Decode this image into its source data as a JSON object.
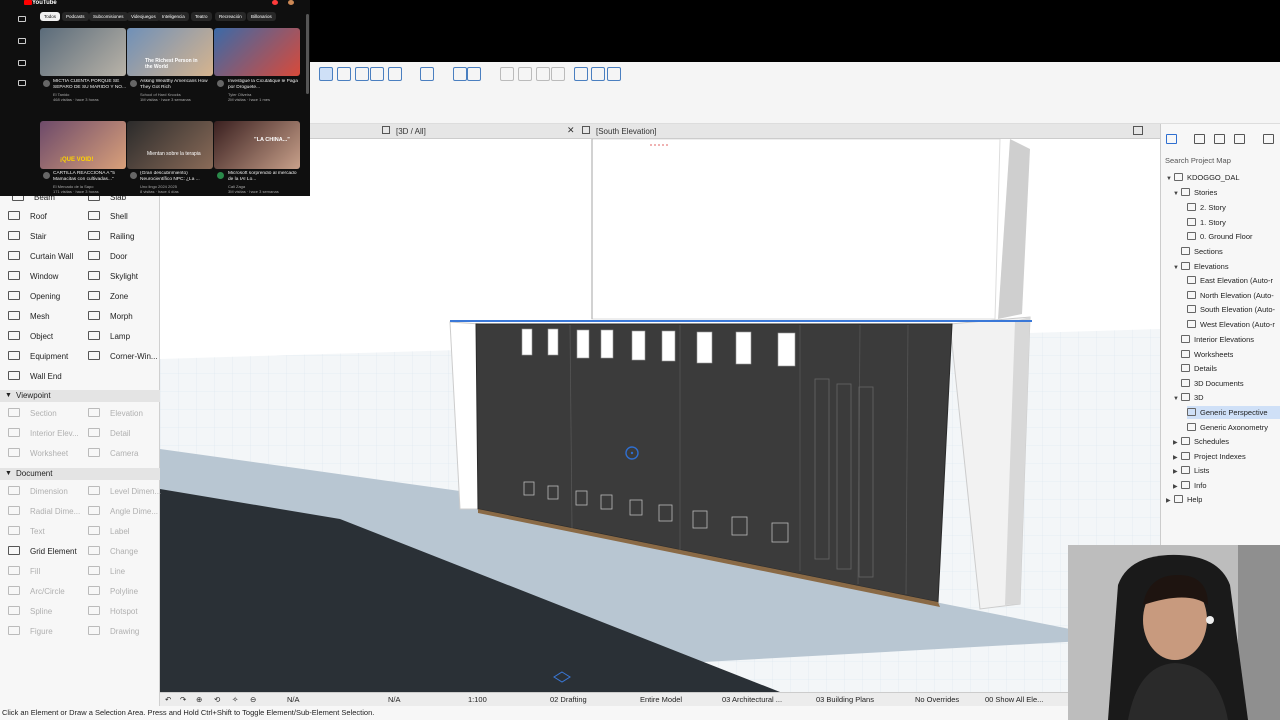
{
  "youtube": {
    "logo": "YouTube",
    "chips": [
      "Todos",
      "Podcasts",
      "Subcomisiones",
      "Videojuegos",
      "Inteligencia",
      "Teatro",
      "Recreación",
      "Billonarios"
    ],
    "videos": [
      {
        "title": "MICTIA CUENTA PORQUE SE SEPARO DE SU MARIDO Y NO...",
        "channel": "El Tanido",
        "meta": "468 visitas · hace 3 horas"
      },
      {
        "title": "Asking Wealthy Americans How They Got Rich",
        "channel": "School of Hard Knocks",
        "meta": "1M visitas · hace 3 semanas"
      },
      {
        "title": "Investigué la Cicutatique le Paga por Droguete...",
        "channel": "Tyler Oliveira",
        "meta": "2M visitas · hace 1 mes"
      },
      {
        "title": "CARTILLA REACCIONA A \"5 Mamacitas con cultivadas...\"",
        "channel": "El Mercado de la Sapo",
        "meta": "171 visitas · hace 3 horas"
      },
      {
        "title": "(Gran descubrimiento) Neurocientífico NPC: ¿La ...",
        "channel": "Uno lingo 2024 2025",
        "meta": "8 visitas · hace 4 días"
      },
      {
        "title": "Microsoft sorprendió al mercado de la IA! Lo...",
        "channel": "Cali Zaga",
        "meta": "3M visitas · hace 3 semanas"
      }
    ],
    "thumb_texts": [
      "The Richest Person in the World",
      "¡QUE VOID!",
      "Mientan sobre la terapia",
      "\"LA CHINA...\""
    ]
  },
  "tabs": [
    {
      "label": "[3D / All]"
    },
    {
      "label": "[South Elevation]"
    }
  ],
  "toolbox": {
    "tools": [
      {
        "label": "Beam"
      },
      {
        "label": "Slab"
      },
      {
        "label": "Roof"
      },
      {
        "label": "Shell"
      },
      {
        "label": "Stair"
      },
      {
        "label": "Railing"
      },
      {
        "label": "Curtain Wall"
      },
      {
        "label": "Door"
      },
      {
        "label": "Window"
      },
      {
        "label": "Skylight"
      },
      {
        "label": "Opening"
      },
      {
        "label": "Zone"
      },
      {
        "label": "Mesh"
      },
      {
        "label": "Morph"
      },
      {
        "label": "Object"
      },
      {
        "label": "Lamp"
      },
      {
        "label": "Equipment"
      },
      {
        "label": "Corner-Win..."
      },
      {
        "label": "Wall End"
      }
    ],
    "viewpoint_header": "Viewpoint",
    "viewpoint_tools": [
      {
        "label": "Section"
      },
      {
        "label": "Elevation"
      },
      {
        "label": "Interior Elev..."
      },
      {
        "label": "Detail"
      },
      {
        "label": "Worksheet"
      },
      {
        "label": "Camera"
      }
    ],
    "document_header": "Document",
    "document_tools": [
      {
        "label": "Dimension"
      },
      {
        "label": "Level Dimen..."
      },
      {
        "label": "Radial Dime..."
      },
      {
        "label": "Angle Dime..."
      },
      {
        "label": "Text"
      },
      {
        "label": "Label"
      },
      {
        "label": "Grid Element"
      },
      {
        "label": "Change"
      },
      {
        "label": "Fill"
      },
      {
        "label": "Line"
      },
      {
        "label": "Arc/Circle"
      },
      {
        "label": "Polyline"
      },
      {
        "label": "Spline"
      },
      {
        "label": "Hotspot"
      },
      {
        "label": "Figure"
      },
      {
        "label": "Drawing"
      }
    ]
  },
  "navigator": {
    "search_placeholder": "Search Project Map",
    "items": [
      {
        "label": "KDOGGO_DAL"
      },
      {
        "label": "Stories"
      },
      {
        "label": "2. Story"
      },
      {
        "label": "1. Story"
      },
      {
        "label": "0. Ground Floor"
      },
      {
        "label": "Sections"
      },
      {
        "label": "Elevations"
      },
      {
        "label": "East Elevation (Auto-r"
      },
      {
        "label": "North Elevation (Auto-"
      },
      {
        "label": "South Elevation (Auto-"
      },
      {
        "label": "West Elevation (Auto-r"
      },
      {
        "label": "Interior Elevations"
      },
      {
        "label": "Worksheets"
      },
      {
        "label": "Details"
      },
      {
        "label": "3D Documents"
      },
      {
        "label": "3D"
      },
      {
        "label": "Generic Perspective"
      },
      {
        "label": "Generic Axonometry"
      },
      {
        "label": "Schedules"
      },
      {
        "label": "Project Indexes"
      },
      {
        "label": "Lists"
      },
      {
        "label": "Info"
      },
      {
        "label": "Help"
      }
    ]
  },
  "statusbar": {
    "na1": "N/A",
    "na2": "N/A",
    "scale": "1:100",
    "layer_combo": "02 Drafting",
    "model_view": "Entire Model",
    "pen_set": "03 Architectural ...",
    "view_option": "03 Building Plans",
    "overrides": "No Overrides",
    "renovation": "00 Show All Ele..."
  },
  "hint": "Click an Element or Draw a Selection Area. Press and Hold Ctrl+Shift to Toggle Element/Sub-Element Selection."
}
